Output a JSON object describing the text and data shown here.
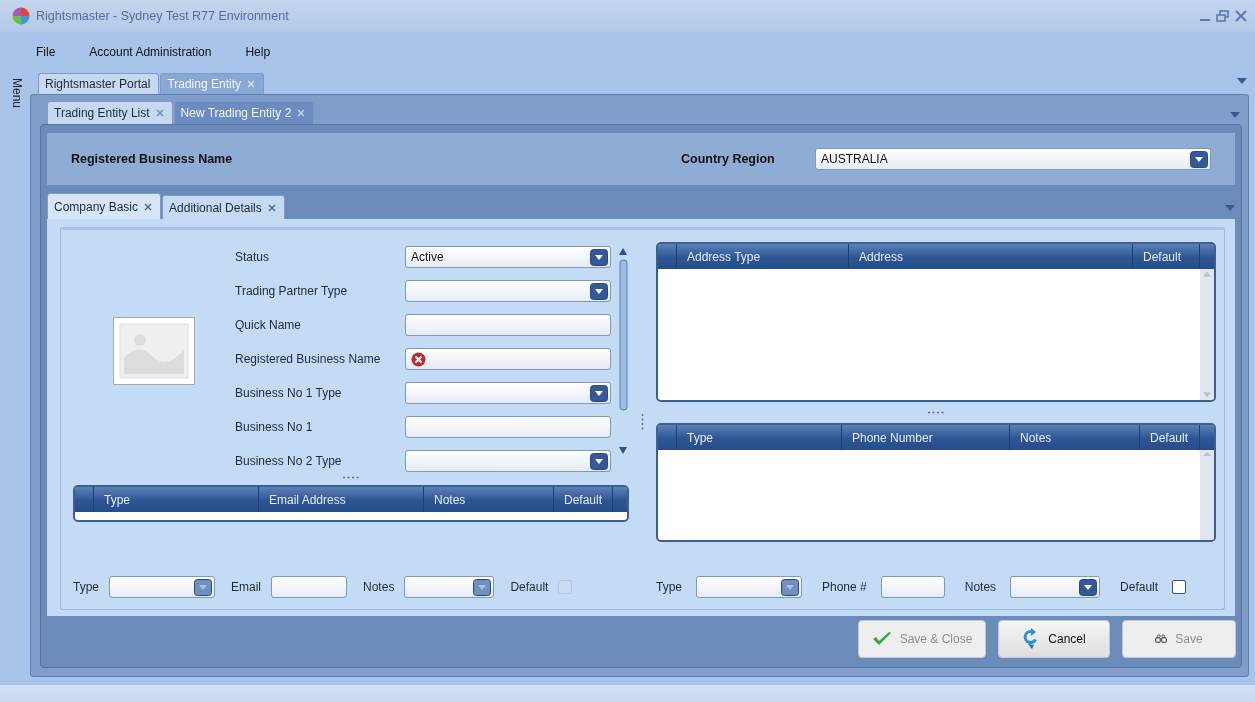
{
  "window": {
    "title": "Rightsmaster - Sydney Test R77 Environment"
  },
  "menu_bar": [
    "File",
    "Account Administration",
    "Help"
  ],
  "side_panel": {
    "label": "Menu"
  },
  "main_tabs": [
    {
      "label": "Rightsmaster Portal",
      "selected": false,
      "closable": false
    },
    {
      "label": "Trading Entity",
      "selected": true,
      "closable": true
    }
  ],
  "entity_tabs": [
    {
      "label": "Trading Entity List",
      "selected": false
    },
    {
      "label": "New Trading Entity 2",
      "selected": true
    }
  ],
  "header": {
    "title": "Registered Business Name",
    "country_label": "Country Region",
    "country_value": "AUSTRALIA"
  },
  "detail_tabs": [
    {
      "label": "Company Basic",
      "selected": true
    },
    {
      "label": "Additional Details",
      "selected": false
    }
  ],
  "fields": [
    {
      "label": "Status",
      "kind": "dropdown",
      "value": "Active"
    },
    {
      "label": "Trading Partner Type",
      "kind": "dropdown"
    },
    {
      "label": "Quick Name",
      "kind": "text"
    },
    {
      "label": "Registered Business Name",
      "kind": "text",
      "error": true
    },
    {
      "label": "Business No 1 Type",
      "kind": "dropdown"
    },
    {
      "label": "Business No 1",
      "kind": "text"
    },
    {
      "label": "Business No 2 Type",
      "kind": "dropdown"
    }
  ],
  "email_grid": {
    "columns": [
      "Type",
      "Email Address",
      "Notes",
      "Default"
    ]
  },
  "email_entry": [
    {
      "kind": "label",
      "text": "Type"
    },
    {
      "kind": "dropdown",
      "disabled": true
    },
    {
      "kind": "label",
      "text": "Email"
    },
    {
      "kind": "text"
    },
    {
      "kind": "label",
      "text": "Notes"
    },
    {
      "kind": "dropdown",
      "disabled": true
    },
    {
      "kind": "label",
      "text": "Default"
    },
    {
      "kind": "checkbox",
      "checked": false,
      "disabled": true
    }
  ],
  "address_grid": {
    "columns": [
      "Address Type",
      "Address",
      "Default"
    ]
  },
  "phone_grid": {
    "columns": [
      "Type",
      "Phone Number",
      "Notes",
      "Default"
    ]
  },
  "phone_entry": [
    {
      "kind": "label",
      "text": "Type"
    },
    {
      "kind": "dropdown",
      "disabled": true
    },
    {
      "kind": "label",
      "text": "Phone #"
    },
    {
      "kind": "text"
    },
    {
      "kind": "label",
      "text": "Notes"
    },
    {
      "kind": "dropdown",
      "disabled": false
    },
    {
      "kind": "label",
      "text": "Default"
    },
    {
      "kind": "checkbox",
      "checked": false,
      "disabled": false
    }
  ],
  "buttons": [
    {
      "label": "Save & Close",
      "disabled": true
    },
    {
      "label": "Cancel",
      "disabled": false
    },
    {
      "label": "Save",
      "disabled": true
    }
  ]
}
